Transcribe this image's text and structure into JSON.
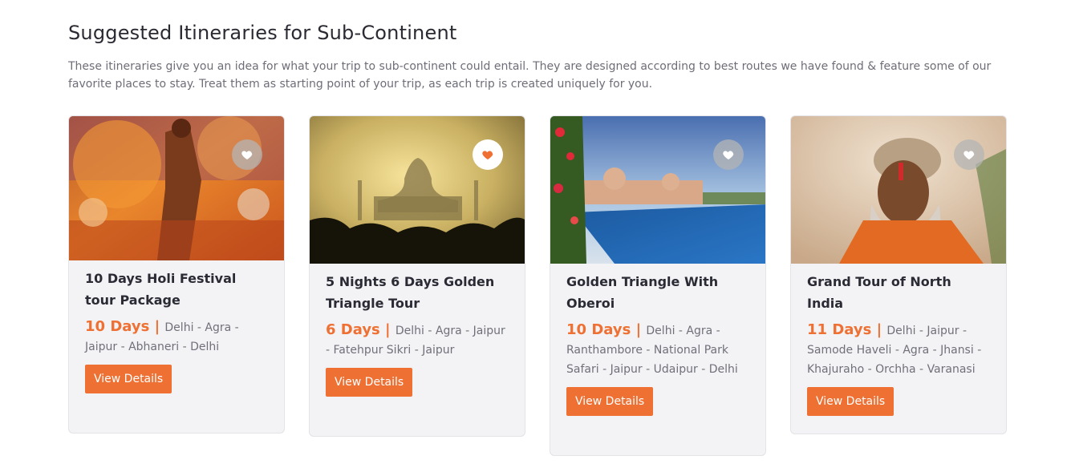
{
  "section": {
    "title": "Suggested Itineraries for Sub-Continent",
    "description": "These itineraries give you an idea for what your trip to sub-continent could entail. They are designed according to best routes we have found & feature some of our favorite places to stay. Treat them as starting point of your trip, as each trip is created uniquely for you."
  },
  "colors": {
    "accent": "#ee7033",
    "card_bg": "#f3f3f5",
    "text_dark": "#2b2b35",
    "text_muted": "#70707a"
  },
  "cards": [
    {
      "image": "holi-festival-photo",
      "favorite": false,
      "title": "10 Days Holi Festival tour Package",
      "duration": "10 Days",
      "route": "Delhi - Agra - Jaipur - Abhaneri - Delhi",
      "button": "View Details"
    },
    {
      "image": "taj-mahal-photo",
      "favorite": true,
      "title": "5 Nights 6 Days Golden Triangle Tour",
      "duration": "6 Days",
      "route": "Delhi - Agra - Jaipur - Fatehpur Sikri - Jaipur",
      "button": "View Details"
    },
    {
      "image": "oberoi-palace-pool-photo",
      "favorite": false,
      "title": "Golden Triangle With Oberoi",
      "duration": "10 Days",
      "route": "Delhi - Agra - Ranthambore - National Park Safari - Jaipur - Udaipur - Delhi",
      "button": "View Details"
    },
    {
      "image": "sadhu-portrait-photo",
      "favorite": false,
      "title": "Grand Tour of North India",
      "duration": "11 Days",
      "route": "Delhi - Jaipur - Samode Haveli - Agra - Jhansi - Khajuraho - Orchha - Varanasi",
      "button": "View Details"
    }
  ]
}
